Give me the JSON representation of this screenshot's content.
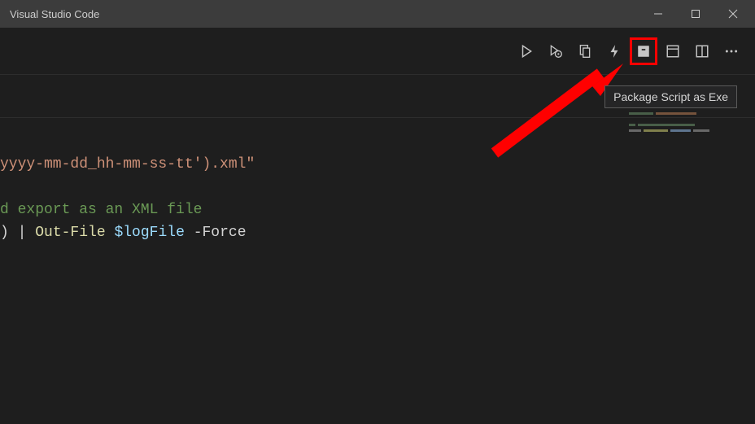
{
  "titlebar": {
    "title": "Visual Studio Code"
  },
  "tooltip": {
    "text": "Package Script as Exe"
  },
  "toolbar": {
    "run": "run",
    "debug": "debug-settings",
    "copy": "copy-file",
    "lightning": "lightning",
    "package": "package",
    "panel": "panel",
    "split": "split-editor",
    "more": "more"
  },
  "code": {
    "line1_string": "yyyy-mm-dd_hh-mm-ss-tt').xml\"",
    "line3_prefix": "d",
    "line3_comment": " export as an XML file",
    "line4_num": ")",
    "line4_pipe": " | ",
    "line4_cmd": "Out-File",
    "line4_sp1": " ",
    "line4_var": "$logFile",
    "line4_sp2": " ",
    "line4_param": "-Force"
  },
  "colors": {
    "highlight": "#ff0000"
  }
}
